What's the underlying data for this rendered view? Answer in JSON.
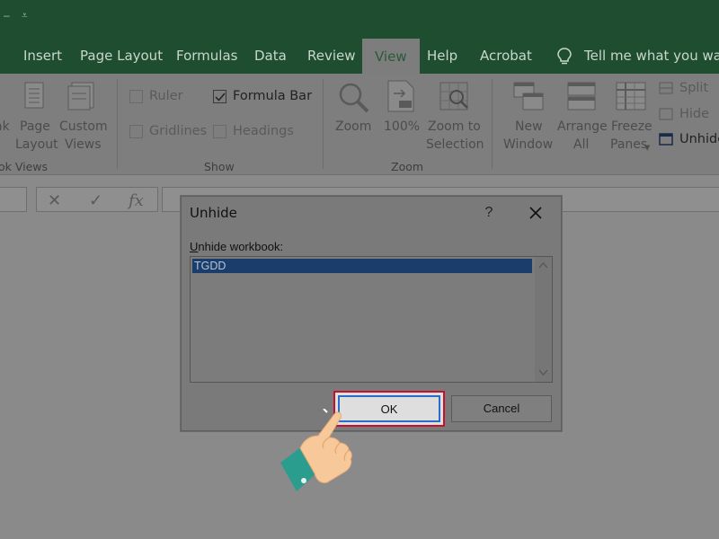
{
  "ribbon_tabs": [
    "Insert",
    "Page Layout",
    "Formulas",
    "Data",
    "Review",
    "View",
    "Help",
    "Acrobat"
  ],
  "active_tab": "View",
  "tell_me": "Tell me what you want",
  "workbook_views": {
    "page_break_label_1": "ak",
    "page_layout_1": "Page",
    "page_layout_2": "Layout",
    "custom_views_1": "Custom",
    "custom_views_2": "Views",
    "group_name": "ok Views"
  },
  "show_group": {
    "ruler": "Ruler",
    "formula_bar": "Formula Bar",
    "gridlines": "Gridlines",
    "headings": "Headings",
    "group_name": "Show"
  },
  "zoom_group": {
    "zoom": "Zoom",
    "hundred": "100%",
    "zoom_to_1": "Zoom to",
    "zoom_to_2": "Selection",
    "group_name": "Zoom"
  },
  "window_group": {
    "new_window_1": "New",
    "new_window_2": "Window",
    "arrange_all_1": "Arrange",
    "arrange_all_2": "All",
    "freeze_panes_1": "Freeze",
    "freeze_panes_2": "Panes",
    "split": "Split",
    "hide": "Hide",
    "unhide": "Unhide"
  },
  "formula_bar": {
    "cancel": "✕",
    "enter": "✓",
    "fx": "fx"
  },
  "dialog": {
    "title": "Unhide",
    "help": "?",
    "list_label_accel": "U",
    "list_label_rest": "nhide workbook:",
    "items": [
      "TGDD"
    ],
    "ok_label": "OK",
    "cancel_label": "Cancel"
  },
  "colors": {
    "title_bar": "#1e4e2f",
    "ok_highlight": "#c8102e",
    "selection": "#1a3d6b",
    "hand_skin": "#f7c99a",
    "cuff": "#2a9d8f"
  }
}
